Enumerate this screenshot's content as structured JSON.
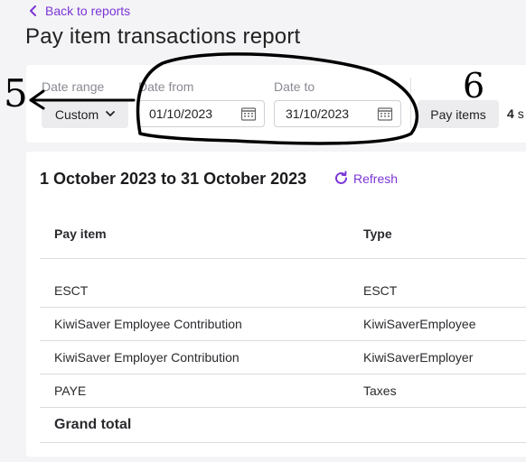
{
  "nav": {
    "back_label": "Back to reports"
  },
  "page": {
    "title": "Pay item transactions report"
  },
  "filters": {
    "date_range": {
      "label": "Date range",
      "value": "Custom"
    },
    "date_from": {
      "label": "Date from",
      "value": "01/10/2023"
    },
    "date_to": {
      "label": "Date to",
      "value": "31/10/2023"
    },
    "pay_items_button": "Pay items",
    "selected_count": "4",
    "selected_suffix": "s"
  },
  "report": {
    "period": "1 October 2023 to 31 October 2023",
    "refresh_label": "Refresh",
    "columns": [
      "Pay item",
      "Type"
    ],
    "rows": [
      {
        "pay_item": "ESCT",
        "type": "ESCT"
      },
      {
        "pay_item": "KiwiSaver Employee Contribution",
        "type": "KiwiSaverEmployee"
      },
      {
        "pay_item": "KiwiSaver Employer Contribution",
        "type": "KiwiSaverEmployer"
      },
      {
        "pay_item": "PAYE",
        "type": "Taxes"
      }
    ],
    "grand_total_label": "Grand total"
  },
  "annotations": {
    "label_left": "5",
    "label_right": "6"
  },
  "colors": {
    "accent": "#7b35d6",
    "page_bg": "#f4f4f6",
    "card_bg": "#ffffff",
    "ink": "#000000"
  },
  "icons": [
    "chevron-left-icon",
    "chevron-down-icon",
    "calendar-icon",
    "refresh-icon"
  ]
}
